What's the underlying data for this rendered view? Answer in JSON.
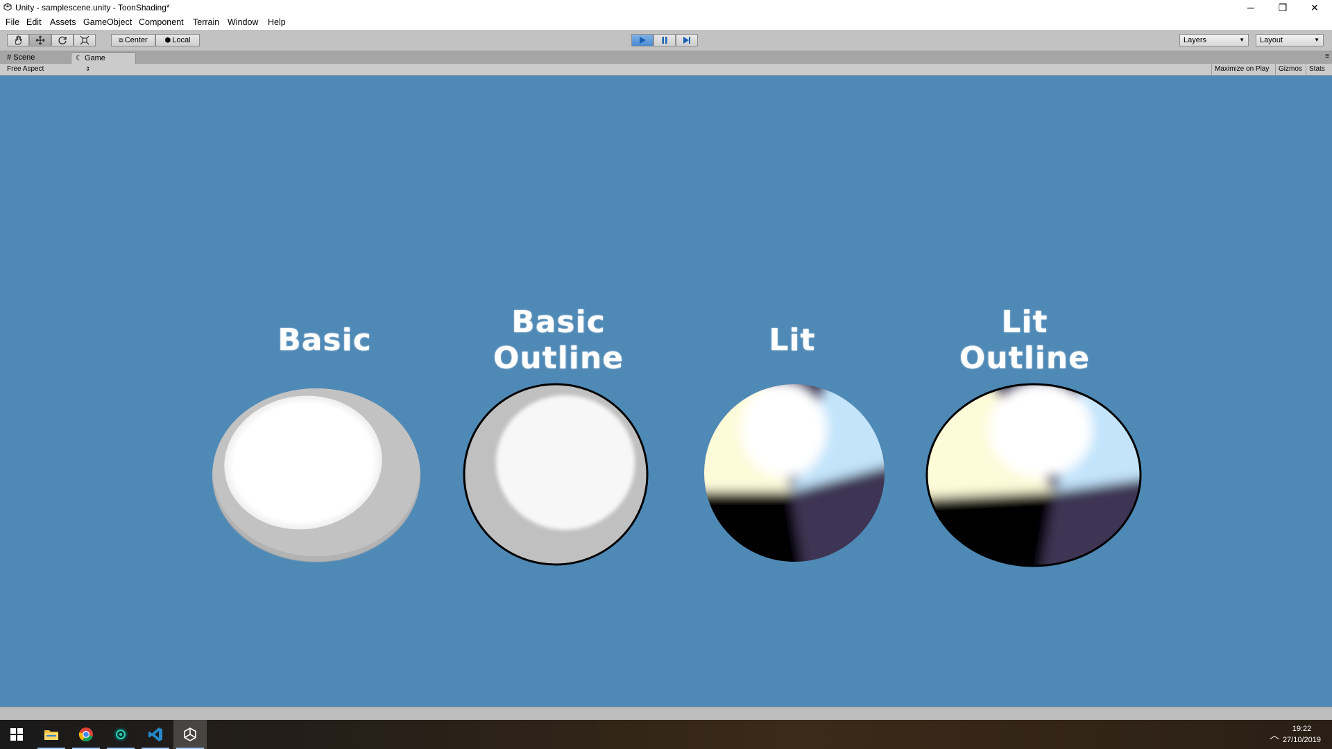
{
  "window": {
    "title": "Unity -  samplescene.unity - ToonShading*",
    "controls": {
      "minimize": "─",
      "maximize": "❐",
      "close": "✕"
    }
  },
  "menu": [
    "File",
    "Edit",
    "Assets",
    "GameObject",
    "Component",
    "Terrain",
    "Window",
    "Help"
  ],
  "toolbar": {
    "pivot_mode": "Center",
    "pivot_rotation": "Local",
    "layers": "Layers",
    "layout": "Layout",
    "play_active": true
  },
  "tabs": [
    {
      "label": "Scene",
      "icon": "scene-icon",
      "active": false
    },
    {
      "label": "Game",
      "icon": "game-icon",
      "active": true
    }
  ],
  "game_toolbar": {
    "aspect": "Free Aspect",
    "maximize_on_play": "Maximize on Play",
    "gizmos": "Gizmos",
    "stats": "Stats"
  },
  "scene": {
    "background_color": "#4f89b6",
    "objects": [
      {
        "label": "Basic",
        "shading": "basic",
        "outline": false
      },
      {
        "label": "Basic\nOutline",
        "shading": "basic",
        "outline": true
      },
      {
        "label": "Lit",
        "shading": "lit",
        "outline": false
      },
      {
        "label": "Lit\nOutline",
        "shading": "lit",
        "outline": true
      }
    ]
  },
  "taskbar": {
    "icons": [
      "windows-start-icon",
      "file-explorer-icon",
      "chrome-icon",
      "app-icon",
      "vscode-icon",
      "unity-icon"
    ],
    "time": "19:22",
    "date": "27/10/2019"
  }
}
